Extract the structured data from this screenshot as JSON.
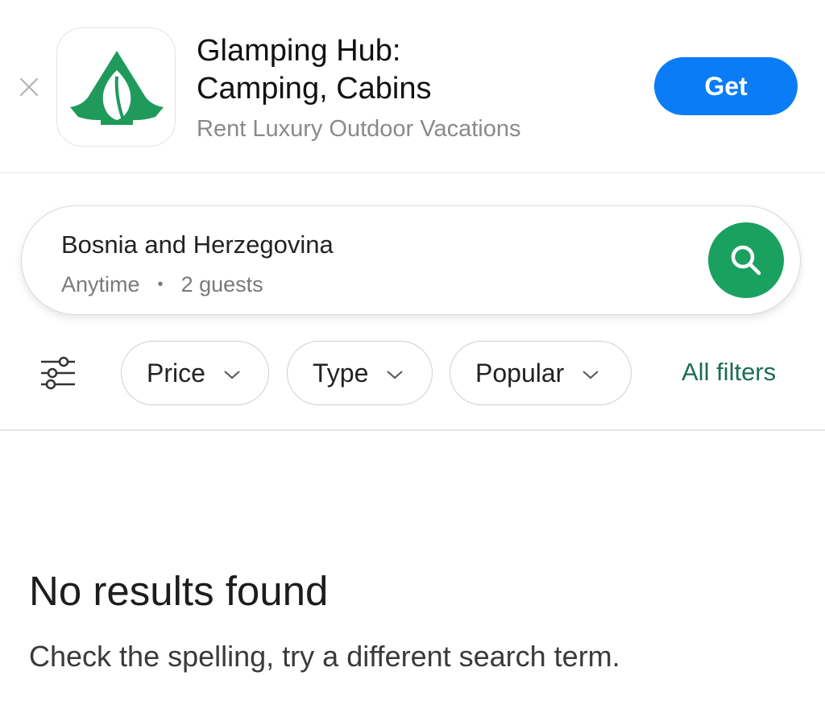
{
  "banner": {
    "close_icon": "close-icon",
    "app_icon": "tent-leaf-icon",
    "app_icon_color": "#1f9a5b",
    "title_line1": "Glamping Hub:",
    "title_line2": "Camping, Cabins",
    "subtitle": "Rent Luxury Outdoor Vacations",
    "get_label": "Get",
    "get_color": "#0a7cf5"
  },
  "search": {
    "location": "Bosnia and Herzegovina",
    "dates": "Anytime",
    "separator": "•",
    "guests": "2 guests",
    "button_icon": "search-icon",
    "button_color": "#1aa160"
  },
  "filters": {
    "filter_icon": "sliders-icon",
    "chips": [
      {
        "label": "Price"
      },
      {
        "label": "Type"
      },
      {
        "label": "Popular"
      }
    ],
    "all_filters_label": "All filters",
    "accent_color": "#1c6e53"
  },
  "empty_state": {
    "title": "No results found",
    "message": "Check the spelling, try a different search term."
  }
}
